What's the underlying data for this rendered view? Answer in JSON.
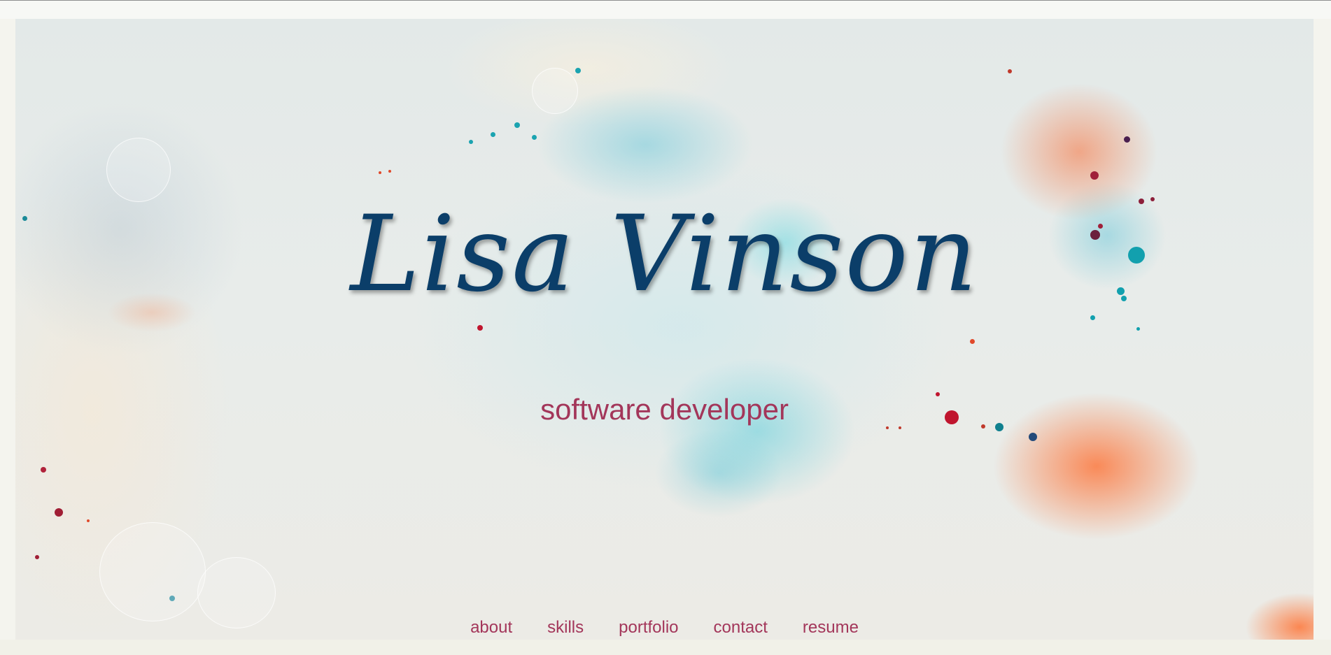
{
  "hero": {
    "name": "Lisa Vinson",
    "role": "software developer"
  },
  "nav": {
    "items": [
      {
        "label": "about",
        "id": "about"
      },
      {
        "label": "skills",
        "id": "skills"
      },
      {
        "label": "portfolio",
        "id": "portfolio"
      },
      {
        "label": "contact",
        "id": "contact"
      },
      {
        "label": "resume",
        "id": "resume"
      }
    ]
  },
  "colors": {
    "name": "#0b3e69",
    "accent": "#a3365a",
    "page_background": "#f4f4ee"
  }
}
